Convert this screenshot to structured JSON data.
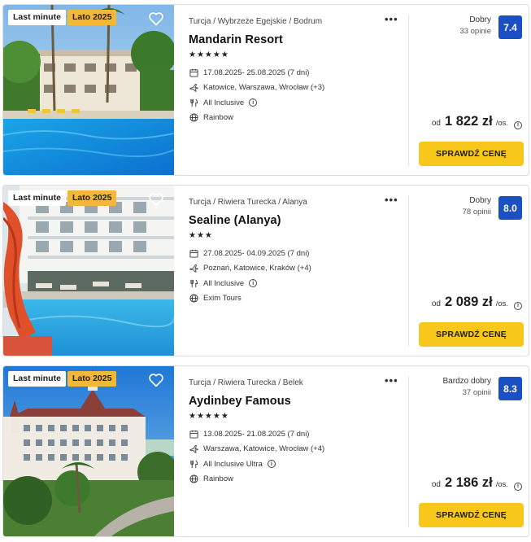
{
  "hotels": [
    {
      "badges": {
        "last_minute": "Last minute",
        "season": "Lato 2025"
      },
      "breadcrumb": "Turcja / Wybrzeże Egejskie / Bodrum",
      "more": "•••",
      "name": "Mandarin Resort",
      "stars": "★★★★★",
      "dates": "17.08.2025- 25.08.2025  (7 dni)",
      "departures": "Katowice, Warszawa, Wrocław  (+3)",
      "board": "All Inclusive",
      "operator": "Rainbow",
      "rating_label": "Dobry",
      "reviews": "33 opinie",
      "score": "7.4",
      "price_prefix": "od",
      "price": "1 822 zł",
      "price_suffix": "/os.",
      "cta": "SPRAWDŹ CENĘ"
    },
    {
      "badges": {
        "last_minute": "Last minute",
        "season": "Lato 2025"
      },
      "breadcrumb": "Turcja / Riwiera Turecka / Alanya",
      "more": "•••",
      "name": "Sealine (Alanya)",
      "stars": "★★★",
      "dates": "27.08.2025- 04.09.2025  (7 dni)",
      "departures": "Poznań, Katowice, Kraków  (+4)",
      "board": "All Inclusive",
      "operator": "Exim Tours",
      "rating_label": "Dobry",
      "reviews": "78 opinii",
      "score": "8.0",
      "price_prefix": "od",
      "price": "2 089 zł",
      "price_suffix": "/os.",
      "cta": "SPRAWDŹ CENĘ"
    },
    {
      "badges": {
        "last_minute": "Last minute",
        "season": "Lato 2025"
      },
      "breadcrumb": "Turcja / Riwiera Turecka / Belek",
      "more": "•••",
      "name": "Aydinbey Famous",
      "stars": "★★★★★",
      "dates": "13.08.2025- 21.08.2025  (7 dni)",
      "departures": "Warszawa, Katowice, Wrocław  (+4)",
      "board": "All Inclusive Ultra",
      "operator": "Rainbow",
      "rating_label": "Bardzo dobry",
      "reviews": "37 opinii",
      "score": "8.3",
      "price_prefix": "od",
      "price": "2 186 zł",
      "price_suffix": "/os.",
      "cta": "SPRAWDŹ CENĘ"
    }
  ],
  "icons": {
    "calendar": "calendar-icon",
    "plane": "plane-icon",
    "board": "cutlery-icon",
    "operator": "globe-icon",
    "favorite": "heart-icon",
    "info": "info-icon",
    "more": "more-icon"
  },
  "colors": {
    "cta": "#f8c71b",
    "season_badge": "#f3b73a",
    "score": "#1b4fc4"
  }
}
